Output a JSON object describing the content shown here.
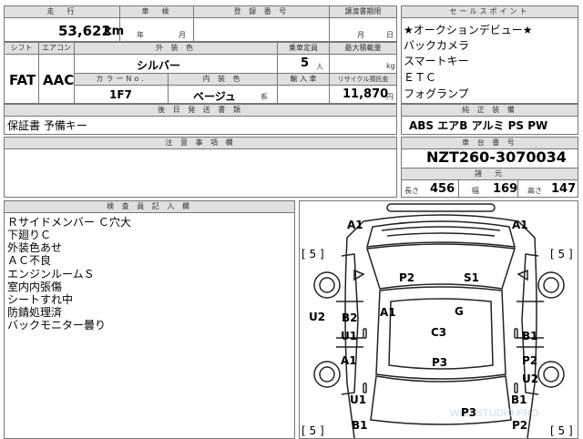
{
  "top": {
    "mileage_label": "走　行",
    "mileage_value": "53,622",
    "mileage_unit": "km",
    "inspection_label": "車　検",
    "year_unit": "年",
    "month_unit": "月",
    "reg_label": "登 録 番 号",
    "transfer_label": "譲渡書期限",
    "transfer_month": "月",
    "transfer_day": "日"
  },
  "spec": {
    "shift_label": "シフト",
    "shift_value": "FAT",
    "ac_label": "エアコン",
    "ac_value": "AAC",
    "exterior_label": "外 装 色",
    "exterior_value": "シルバー",
    "capacity_label": "乗車定員",
    "capacity_value": "5",
    "capacity_unit": "人",
    "load_label": "最大積載量",
    "load_unit": "kg",
    "color_no_label": "カラーNo.",
    "color_no_value": "1F7",
    "interior_label": "内 装 色",
    "interior_value": "ベージュ",
    "interior_suffix": "系",
    "import_label": "輸 入 車",
    "recycle_label": "リサイクル預託金",
    "recycle_value": "11,870",
    "recycle_unit": "円"
  },
  "docs": {
    "label": "後 日 発 送 書 類",
    "value": "保証書 予備キー"
  },
  "sales": {
    "label": "セールスポイント",
    "items": [
      "★オークションデビュー★",
      "バックカメラ",
      "スマートキー",
      "ＥＴＣ",
      "フォグランプ"
    ]
  },
  "equipment": {
    "label": "純 正 装 備",
    "value": "ABS エアB アルミ PS PW"
  },
  "notes": {
    "label": "注 意 事 項 欄"
  },
  "chassis": {
    "label": "車 台 番 号",
    "value": "NZT260-3070034"
  },
  "dims": {
    "label": "諸　元",
    "length_label": "長さ",
    "length_value": "456",
    "width_label": "幅",
    "width_value": "169",
    "height_label": "高さ",
    "height_value": "147"
  },
  "inspector": {
    "label": "検 査 員 記 入 欄",
    "lines": [
      "Ｒサイドメンバー Ｃ穴大",
      "下廻りＣ",
      "外装色あせ",
      "ＡＣ不良",
      "エンジンルームＳ",
      "室内内張傷",
      "シートすれ中",
      "防錆処理済",
      "バックモニター曇り"
    ]
  },
  "diagram": {
    "labels": [
      "A1",
      "A1",
      "[ 5 ]",
      "[ 5 ]",
      "P2",
      "S1",
      "A1",
      "G",
      "U2",
      "B2",
      "U1",
      "C3",
      "B1",
      "A1",
      "P3",
      "P2",
      "U2",
      "U1",
      "B1",
      "P3",
      "[ 5 ]",
      "B1",
      "[ 5 ]",
      "P2"
    ],
    "watermark": "WEB-STUDIO.PRO"
  }
}
